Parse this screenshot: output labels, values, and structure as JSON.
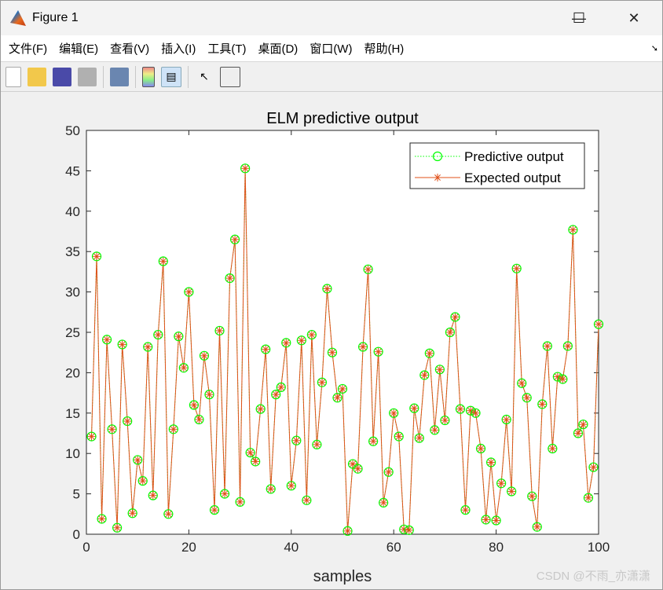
{
  "window": {
    "title": "Figure 1",
    "minimize": "—",
    "maximize": "☐",
    "close": "✕"
  },
  "menu": [
    "文件(F)",
    "编辑(E)",
    "查看(V)",
    "插入(I)",
    "工具(T)",
    "桌面(D)",
    "窗口(W)",
    "帮助(H)"
  ],
  "toolbar": [
    "new-figure",
    "open-file",
    "save",
    "print",
    "link-plot",
    "insert-colorbar",
    "insert-legend",
    "edit-plot",
    "property-inspector"
  ],
  "watermark": "CSDN @不雨_亦潇潇",
  "chart_data": {
    "type": "line",
    "title": "ELM predictive output",
    "xlabel": "samples",
    "ylabel": "",
    "xlim": [
      0,
      100
    ],
    "ylim": [
      0,
      50
    ],
    "xticks": [
      0,
      20,
      40,
      60,
      80,
      100
    ],
    "yticks": [
      0,
      5,
      10,
      15,
      20,
      25,
      30,
      35,
      40,
      45,
      50
    ],
    "legend_position": "top-right",
    "x": [
      1,
      2,
      3,
      4,
      5,
      6,
      7,
      8,
      9,
      10,
      11,
      12,
      13,
      14,
      15,
      16,
      17,
      18,
      19,
      20,
      21,
      22,
      23,
      24,
      25,
      26,
      27,
      28,
      29,
      30,
      31,
      32,
      33,
      34,
      35,
      36,
      37,
      38,
      39,
      40,
      41,
      42,
      43,
      44,
      45,
      46,
      47,
      48,
      49,
      50,
      51,
      52,
      53,
      54,
      55,
      56,
      57,
      58,
      59,
      60,
      61,
      62,
      63,
      64,
      65,
      66,
      67,
      68,
      69,
      70,
      71,
      72,
      73,
      74,
      75,
      76,
      77,
      78,
      79,
      80,
      81,
      82,
      83,
      84,
      85,
      86,
      87,
      88,
      89,
      90,
      91,
      92,
      93,
      94,
      95,
      96,
      97,
      98,
      99,
      100
    ],
    "series": [
      {
        "name": "Predictive output",
        "color": "#00ff00",
        "style": "dotted-circle",
        "values": [
          12.1,
          34.4,
          1.9,
          24.1,
          13.0,
          0.8,
          23.5,
          14.0,
          2.6,
          9.2,
          6.6,
          23.2,
          4.8,
          24.7,
          33.8,
          2.5,
          13.0,
          24.5,
          20.6,
          30.0,
          16.0,
          14.2,
          22.1,
          17.3,
          3.0,
          25.2,
          5.0,
          31.7,
          36.5,
          4.0,
          45.3,
          10.1,
          9.0,
          15.5,
          22.9,
          5.6,
          17.3,
          18.2,
          23.7,
          6.0,
          11.6,
          24.0,
          4.2,
          24.7,
          11.1,
          18.8,
          30.4,
          22.5,
          16.9,
          18.0,
          0.4,
          8.7,
          8.1,
          23.2,
          32.8,
          11.5,
          22.6,
          3.9,
          7.7,
          15.0,
          12.1,
          0.6,
          0.5,
          15.6,
          11.9,
          19.7,
          22.4,
          12.9,
          20.4,
          14.1,
          25.0,
          26.9,
          15.5,
          3.0,
          15.3,
          15.0,
          10.6,
          1.8,
          8.9,
          1.7,
          6.3,
          14.2,
          5.3,
          32.9,
          18.7,
          16.9,
          4.7,
          0.9,
          16.1,
          23.3,
          10.6,
          19.5,
          19.2,
          23.3,
          37.7,
          12.5,
          13.6,
          4.5,
          8.3,
          26.0
        ]
      },
      {
        "name": "Expected output",
        "color": "#e0501a",
        "style": "solid-asterisk",
        "values": [
          12.1,
          34.4,
          1.9,
          24.1,
          13.0,
          0.8,
          23.5,
          14.0,
          2.6,
          9.2,
          6.6,
          23.2,
          4.8,
          24.7,
          33.8,
          2.5,
          13.0,
          24.5,
          20.6,
          30.0,
          16.0,
          14.2,
          22.1,
          17.3,
          3.0,
          25.2,
          5.0,
          31.7,
          36.5,
          4.0,
          45.3,
          10.1,
          9.0,
          15.5,
          22.9,
          5.6,
          17.3,
          18.2,
          23.7,
          6.0,
          11.6,
          24.0,
          4.2,
          24.7,
          11.1,
          18.8,
          30.4,
          22.5,
          16.9,
          18.0,
          0.4,
          8.7,
          8.1,
          23.2,
          32.8,
          11.5,
          22.6,
          3.9,
          7.7,
          15.0,
          12.1,
          0.6,
          0.5,
          15.6,
          11.9,
          19.7,
          22.4,
          12.9,
          20.4,
          14.1,
          25.0,
          26.9,
          15.5,
          3.0,
          15.3,
          15.0,
          10.6,
          1.8,
          8.9,
          1.7,
          6.3,
          14.2,
          5.3,
          32.9,
          18.7,
          16.9,
          4.7,
          0.9,
          16.1,
          23.3,
          10.6,
          19.5,
          19.2,
          23.3,
          37.7,
          12.5,
          13.6,
          4.5,
          8.3,
          26.0
        ]
      }
    ]
  }
}
